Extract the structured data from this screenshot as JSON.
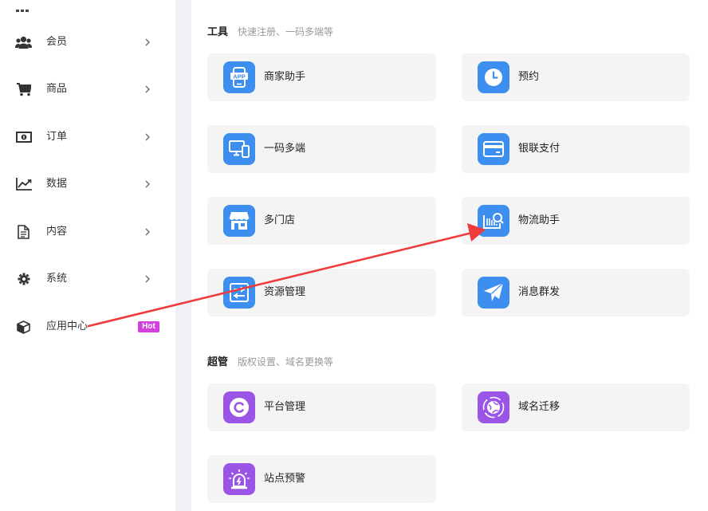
{
  "sidebar": {
    "items": [
      {
        "label": "会员",
        "icon": "users-icon"
      },
      {
        "label": "商品",
        "icon": "cart-icon"
      },
      {
        "label": "订单",
        "icon": "money-icon"
      },
      {
        "label": "数据",
        "icon": "chart-icon"
      },
      {
        "label": "内容",
        "icon": "document-icon"
      },
      {
        "label": "系统",
        "icon": "gear-icon"
      },
      {
        "label": "应用中心",
        "icon": "box-icon",
        "badge": "Hot"
      }
    ]
  },
  "sections": {
    "tools": {
      "title": "工具",
      "desc": "快速注册、一码多端等",
      "cards": [
        {
          "label": "商家助手",
          "icon": "app-phone-icon"
        },
        {
          "label": "预约",
          "icon": "clock-icon"
        },
        {
          "label": "一码多端",
          "icon": "devices-icon"
        },
        {
          "label": "银联支付",
          "icon": "card-icon"
        },
        {
          "label": "多门店",
          "icon": "store-icon"
        },
        {
          "label": "物流助手",
          "icon": "logistics-icon"
        },
        {
          "label": "资源管理",
          "icon": "resource-icon"
        },
        {
          "label": "消息群发",
          "icon": "send-icon"
        }
      ]
    },
    "admin": {
      "title": "超管",
      "desc": "版权设置、域名更换等",
      "cards": [
        {
          "label": "平台管理",
          "icon": "copyright-icon"
        },
        {
          "label": "域名迁移",
          "icon": "globe-icon"
        },
        {
          "label": "站点预警",
          "icon": "alarm-icon"
        }
      ]
    }
  },
  "colors": {
    "icon_blue": "#3c8fee",
    "icon_purple": "#9a55e6",
    "hot_badge": "#d43fe0",
    "annotation_arrow": "#ee3b3b"
  }
}
